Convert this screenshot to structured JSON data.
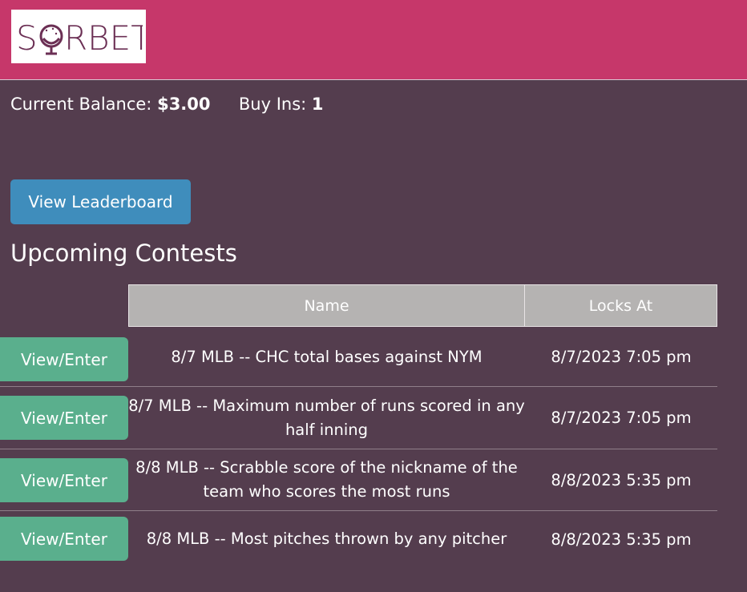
{
  "header": {
    "logo_text": "SORBET"
  },
  "account": {
    "balance_label": "Current Balance:",
    "balance_value": "$3.00",
    "buyins_label": "Buy Ins:",
    "buyins_value": "1"
  },
  "leaderboard_button": "View Leaderboard",
  "contests": {
    "title": "Upcoming Contests",
    "columns": [
      "Name",
      "Locks At"
    ],
    "rows": [
      {
        "action": "View/Enter",
        "name": "8/7 MLB -- CHC total bases against NYM",
        "locks_at": "8/7/2023 7:05 pm"
      },
      {
        "action": "View/Enter",
        "name": "8/7 MLB -- Maximum number of runs scored in any half inning",
        "locks_at": "8/7/2023 7:05 pm"
      },
      {
        "action": "View/Enter",
        "name": "8/8 MLB -- Scrabble score of the nickname of the team who scores the most runs",
        "locks_at": "8/8/2023 5:35 pm"
      },
      {
        "action": "View/Enter",
        "name": "8/8 MLB -- Most pitches thrown by any pitcher",
        "locks_at": "8/8/2023 5:35 pm"
      }
    ]
  },
  "colors": {
    "header_bg": "#c6376a",
    "page_bg": "#543d4e",
    "primary_button": "#3f8dbc",
    "enter_button": "#5aaf8d",
    "table_header": "#b5b3b2"
  }
}
